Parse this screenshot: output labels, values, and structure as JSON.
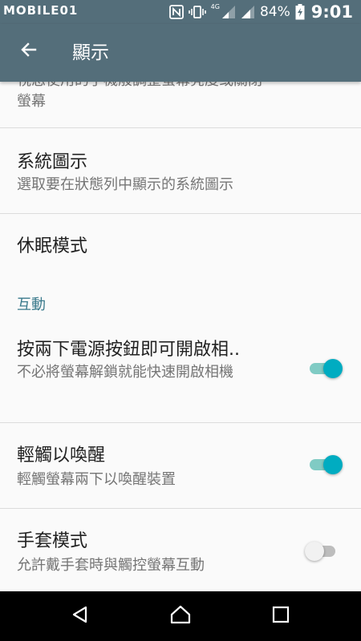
{
  "status_bar": {
    "watermark": "MOBILE01",
    "network_label": "4G",
    "battery_percent": "84%",
    "time": "9:01"
  },
  "toolbar": {
    "title": "顯示"
  },
  "items": {
    "brightness_summary_partial": "視您使用的手機般調整螢幕亮度或關閉",
    "brightness_summary_line2": "螢幕",
    "system_icons": {
      "title": "系統圖示",
      "summary": "選取要在狀態列中顯示的系統圖示"
    },
    "sleep": {
      "title": "休眠模式"
    },
    "double_tap_camera": {
      "title": "按兩下電源按鈕即可開啟相..",
      "summary": "不必將螢幕解鎖就能快速開啟相機",
      "enabled": true
    },
    "tap_to_wake": {
      "title": "輕觸以喚醒",
      "summary": "輕觸螢幕兩下以喚醒裝置",
      "enabled": true
    },
    "glove_mode": {
      "title": "手套模式",
      "summary": "允許戴手套時與觸控螢幕互動",
      "enabled": false
    }
  },
  "section_interaction": "互動",
  "colors": {
    "primary": "#546e7a",
    "accent": "#00acc1",
    "section_header": "#3a7a8c"
  },
  "nav": {
    "back_icon": "triangle-back-icon",
    "home_icon": "house-home-icon",
    "recents_icon": "square-recents-icon"
  }
}
